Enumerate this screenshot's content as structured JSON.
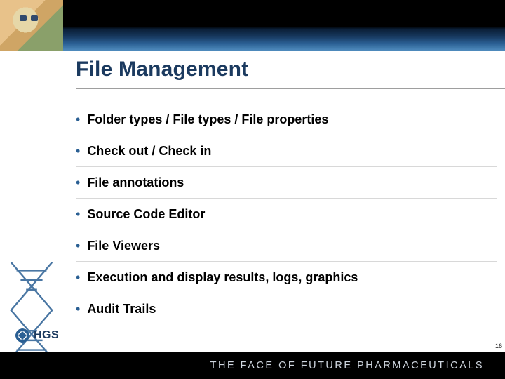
{
  "title": "File Management",
  "bullets": [
    "Folder types / File types / File properties",
    "Check out / Check in",
    "File annotations",
    "Source Code Editor",
    "File Viewers",
    "Execution and display results, logs, graphics",
    "Audit Trails"
  ],
  "logo_text": "HGS",
  "tagline": "THE FACE OF FUTURE PHARMACEUTICALS",
  "page_number": "16"
}
